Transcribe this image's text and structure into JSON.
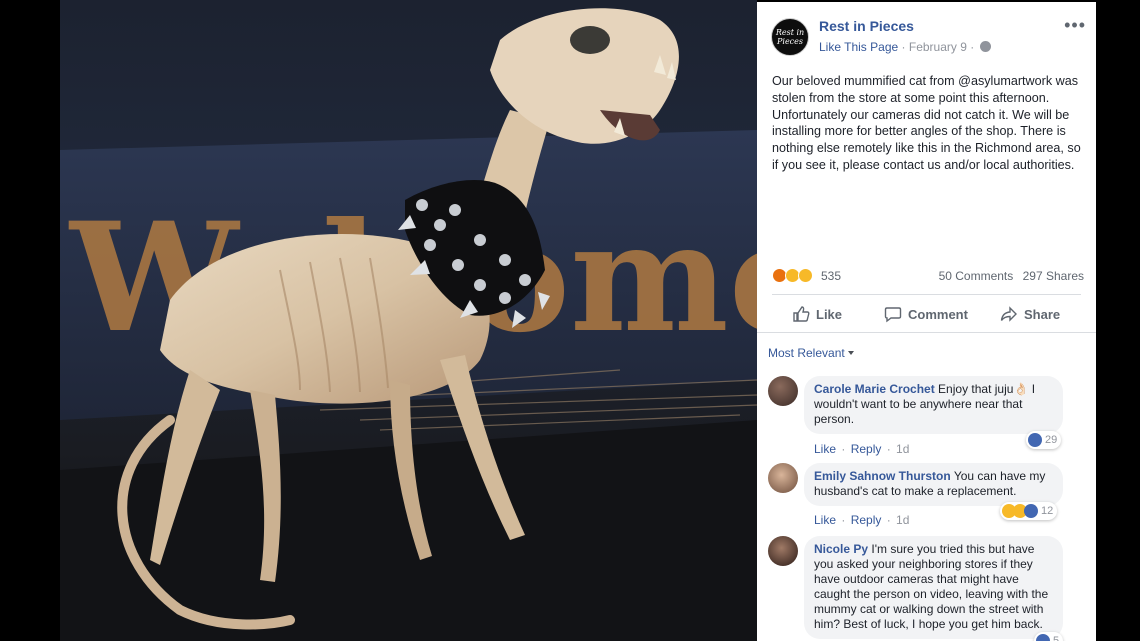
{
  "post": {
    "page_name": "Rest in Pieces",
    "avatar_text": "Rest in Pieces",
    "like_page": "Like This Page",
    "separator": "·",
    "date": "February 9",
    "more": "•••",
    "text": "Our beloved mummified cat from @asylumartwork was stolen from the store at some point this afternoon. Unfortunately our cameras did not catch it. We will be installing more for better angles of the shop. There is nothing else remotely like this in the Richmond area, so if you see it, please contact us and/or local authorities.",
    "reaction_count": "535",
    "comments_count": "50 Comments",
    "shares_count": "297 Shares"
  },
  "actions": {
    "like": "Like",
    "comment": "Comment",
    "share": "Share"
  },
  "sort": {
    "label": "Most Relevant"
  },
  "comments": [
    {
      "author": "Carole Marie Crochet",
      "text": "Enjoy that juju",
      "emoji": "👌🏻",
      "text2": " I wouldn't want to be anywhere near that person.",
      "like": "Like",
      "reply": "Reply",
      "time": "1d",
      "reactions": "29"
    },
    {
      "author": "Emily Sahnow Thurston",
      "text": "You can have my husband's cat to make a replacement.",
      "like": "Like",
      "reply": "Reply",
      "time": "1d",
      "reactions": "12"
    },
    {
      "author": "Nicole Py",
      "text": "I'm sure you tried this but have you asked your neighboring stores if they have outdoor cameras that might have caught the person on video, leaving with the mummy cat or walking down the street with him? Best of luck, I hope you get him back.",
      "reactions": "5"
    }
  ],
  "colors": {
    "link": "#365899",
    "muted": "#90949c",
    "bubble": "#f2f3f5",
    "like_blue": "#4267b2",
    "haha_yellow": "#f7b928",
    "angry_red": "#e9710f"
  },
  "photo": {
    "sign_text": "Welcome"
  }
}
